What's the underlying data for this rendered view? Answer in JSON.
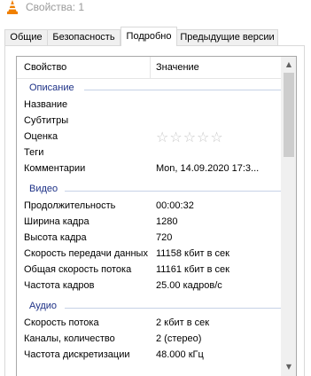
{
  "window": {
    "title": "Свойства: 1",
    "icon": "vlc-cone-icon",
    "accent": "#f08000"
  },
  "tabs": [
    {
      "label": "Общие"
    },
    {
      "label": "Безопасность"
    },
    {
      "label": "Подробно",
      "active": true
    },
    {
      "label": "Предыдущие версии"
    }
  ],
  "table": {
    "headers": {
      "property": "Свойство",
      "value": "Значение"
    },
    "groups": [
      {
        "name": "Описание",
        "rows": [
          {
            "property": "Название",
            "value": ""
          },
          {
            "property": "Субтитры",
            "value": ""
          },
          {
            "property": "Оценка",
            "value": "",
            "rating_stars": 5,
            "rating": 0
          },
          {
            "property": "Теги",
            "value": ""
          },
          {
            "property": "Комментарии",
            "value": "Mon, 14.09.2020 17:3..."
          }
        ]
      },
      {
        "name": "Видео",
        "rows": [
          {
            "property": "Продолжительность",
            "value": "00:00:32"
          },
          {
            "property": "Ширина кадра",
            "value": "1280"
          },
          {
            "property": "Высота кадра",
            "value": "720"
          },
          {
            "property": "Скорость передачи данных",
            "value": "11158 кбит в сек"
          },
          {
            "property": "Общая скорость потока",
            "value": "11161 кбит в сек"
          },
          {
            "property": "Частота кадров",
            "value": "25.00 кадров/с"
          }
        ]
      },
      {
        "name": "Аудио",
        "rows": [
          {
            "property": "Скорость потока",
            "value": "2 кбит в сек"
          },
          {
            "property": "Каналы, количество",
            "value": "2 (стерео)"
          },
          {
            "property": "Частота дискретизации",
            "value": "48.000 кГц"
          }
        ]
      }
    ]
  },
  "colors": {
    "group_label": "#1e3287",
    "group_line": "#c6d2e6",
    "star": "#c8c8c8"
  }
}
